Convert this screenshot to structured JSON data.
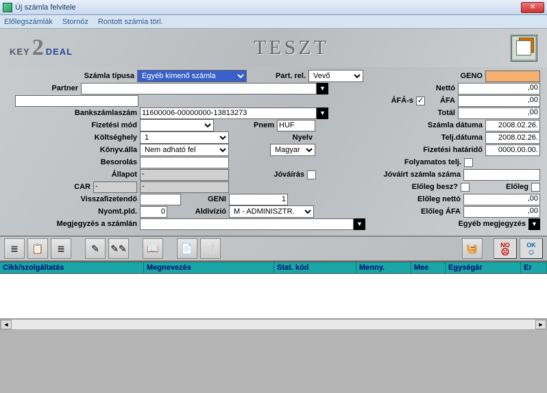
{
  "window": {
    "title": "Új számla felvitele"
  },
  "menu": {
    "m1": "Előlegszámlák",
    "m2": "Stornóz",
    "m3": "Rontott számla törl."
  },
  "banner": {
    "teszt": "TESZT"
  },
  "labels": {
    "szamla_tipusa": "Számla típusa",
    "part_rel": "Part. rel.",
    "geno": "GENO",
    "partner": "Partner",
    "netto": "Nettó",
    "afas": "ÁFÁ-s",
    "afa": "ÁFA",
    "bankszamlaszam": "Bankszámlaszám",
    "total": "Totál",
    "fizetesi_mod": "Fizetési mód",
    "pnem": "Pnem",
    "szamla_datuma": "Számla dátuma",
    "koltseghely": "Költséghely",
    "nyelv": "Nyelv",
    "telj_datuma": "Telj.dátuma",
    "konyv_alla": "Könyv.álla",
    "fizetesi_hatarido": "Fizetési határidő",
    "besorolas": "Besorolás",
    "folyamatos_telj": "Folyamatos telj.",
    "allapot": "Állapot",
    "jovairas": "Jóváírás",
    "jovairt_szamla_szama": "Jóváírt számla száma",
    "car": "CAR",
    "eloleg_besz": "Előleg besz?",
    "eloleg": "Előleg",
    "visszafizetendo": "Visszafizetendő",
    "geni": "GENI",
    "eloleg_netto": "Előleg nettó",
    "nyomt_pld": "Nyomt.pld.",
    "aldivizio": "Aldivízió",
    "eloleg_afa": "Előleg ÁFA",
    "megjegyzes": "Megjegyzés a számlán",
    "egyeb_megj": "Egyéb megjegyzés"
  },
  "values": {
    "szamla_tipusa": "Egyéb kimenő számla",
    "part_rel": "Vevő",
    "geno": "",
    "partner": "",
    "netto": ",00",
    "afa": ",00",
    "bankszamlaszam": "11600006-00000000-13813273",
    "total": ",00",
    "fizetesi_mod": "",
    "pnem": "HUF",
    "szamla_datuma": "2008.02.26.",
    "koltseghely": "1",
    "nyelv": "Magyar",
    "telj_datuma": "2008.02.26.",
    "konyv_alla": "Nem adható fel",
    "fizetesi_hatarido": "0000.00.00.",
    "besorolas": "",
    "allapot": "-",
    "jovairt": "",
    "car1": "-",
    "car2": "-",
    "visszafiz": "",
    "geni": "1",
    "eloleg_netto": ",00",
    "nyomt_pld": "0",
    "aldivizio": "M - ADMINISZTR.",
    "eloleg_afa": ",00",
    "megjegyzes": ""
  },
  "checks": {
    "afas": true,
    "jovairas": false,
    "folyamatos": false,
    "eloleg_besz": false,
    "eloleg": false
  },
  "buttons": {
    "no": "NO",
    "ok": "OK"
  },
  "grid": {
    "cikk": "Cikk/szolgáltatás",
    "megnevezes": "Megnevezés",
    "stat_kod": "Stat. kód",
    "menny": "Menny.",
    "mee": "Mee",
    "egysegar": "Egységár",
    "er": "Er"
  }
}
